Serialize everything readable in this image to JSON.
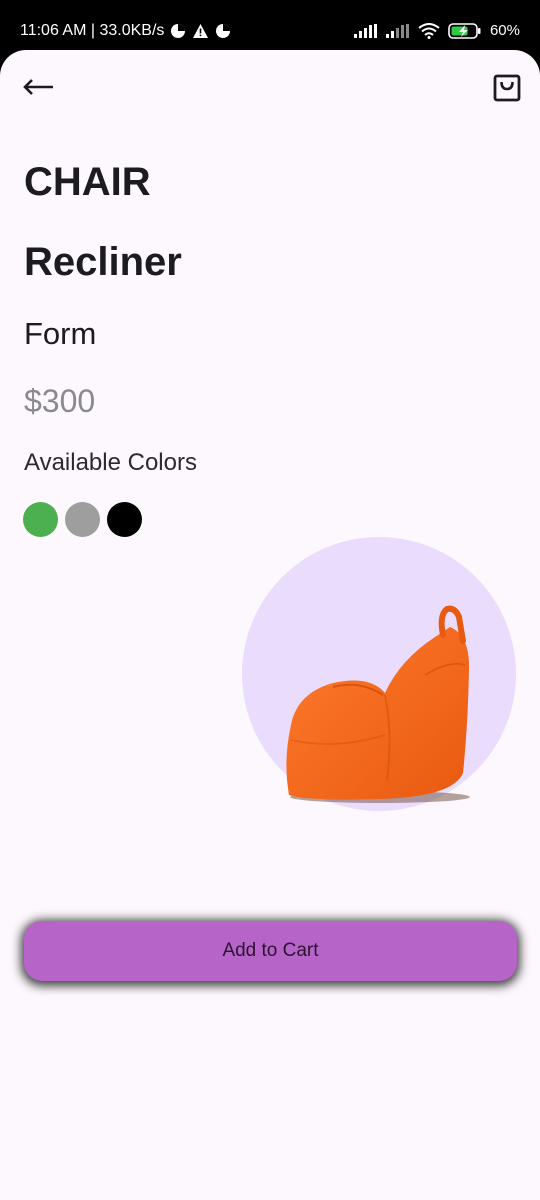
{
  "status_bar": {
    "time_speed": "11:06 AM | 33.0KB/s",
    "battery": "60%",
    "icons": [
      "data-saver-icon",
      "warning-icon",
      "data-saver-icon",
      "signal-icon",
      "signal-icon",
      "wifi-icon",
      "battery-charging-icon"
    ]
  },
  "top_bar": {
    "back_icon": "arrow-left-icon",
    "bag_icon": "shopping-bag-icon"
  },
  "product": {
    "category": "CHAIR",
    "name": "Recliner",
    "form": "Form",
    "price": "$300",
    "colors_label": "Available Colors",
    "colors": [
      "#4caf50",
      "#9e9e9e",
      "#000000"
    ],
    "image_icon": "bean-bag-chair-image",
    "circle_color": "#e9dcfc"
  },
  "cart_button": {
    "label": "Add to Cart",
    "color": "#b764c8"
  }
}
